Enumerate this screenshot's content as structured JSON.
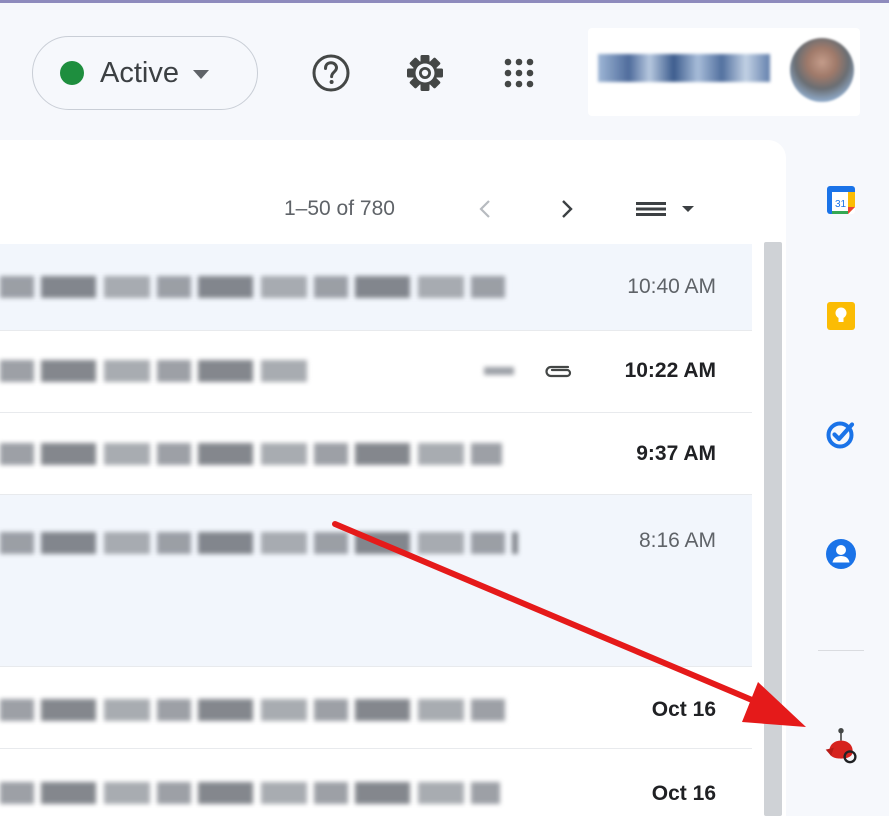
{
  "status": {
    "label": "Active",
    "color": "#1e8e3e"
  },
  "topbar": {
    "help_icon": "help-circle-icon",
    "settings_icon": "gear-icon",
    "apps_icon": "apps-grid-icon"
  },
  "pagination": {
    "range": "1–50 of 780"
  },
  "emails": [
    {
      "time": "10:40 AM",
      "unread": false,
      "attachment": false
    },
    {
      "time": "10:22 AM",
      "unread": true,
      "attachment": true
    },
    {
      "time": "9:37 AM",
      "unread": true,
      "attachment": false
    },
    {
      "time": "8:16 AM",
      "unread": false,
      "attachment": false
    },
    {
      "time": "Oct 16",
      "unread": true,
      "attachment": false
    },
    {
      "time": "Oct 16",
      "unread": true,
      "attachment": false
    }
  ],
  "side_panel": {
    "calendar_date": "31",
    "apps": [
      "calendar-icon",
      "keep-icon",
      "tasks-icon",
      "contacts-icon",
      "addon-icon"
    ]
  },
  "colors": {
    "accent_red": "#e51a1a",
    "keep_yellow": "#fbbc04",
    "google_blue": "#1a73e8"
  }
}
